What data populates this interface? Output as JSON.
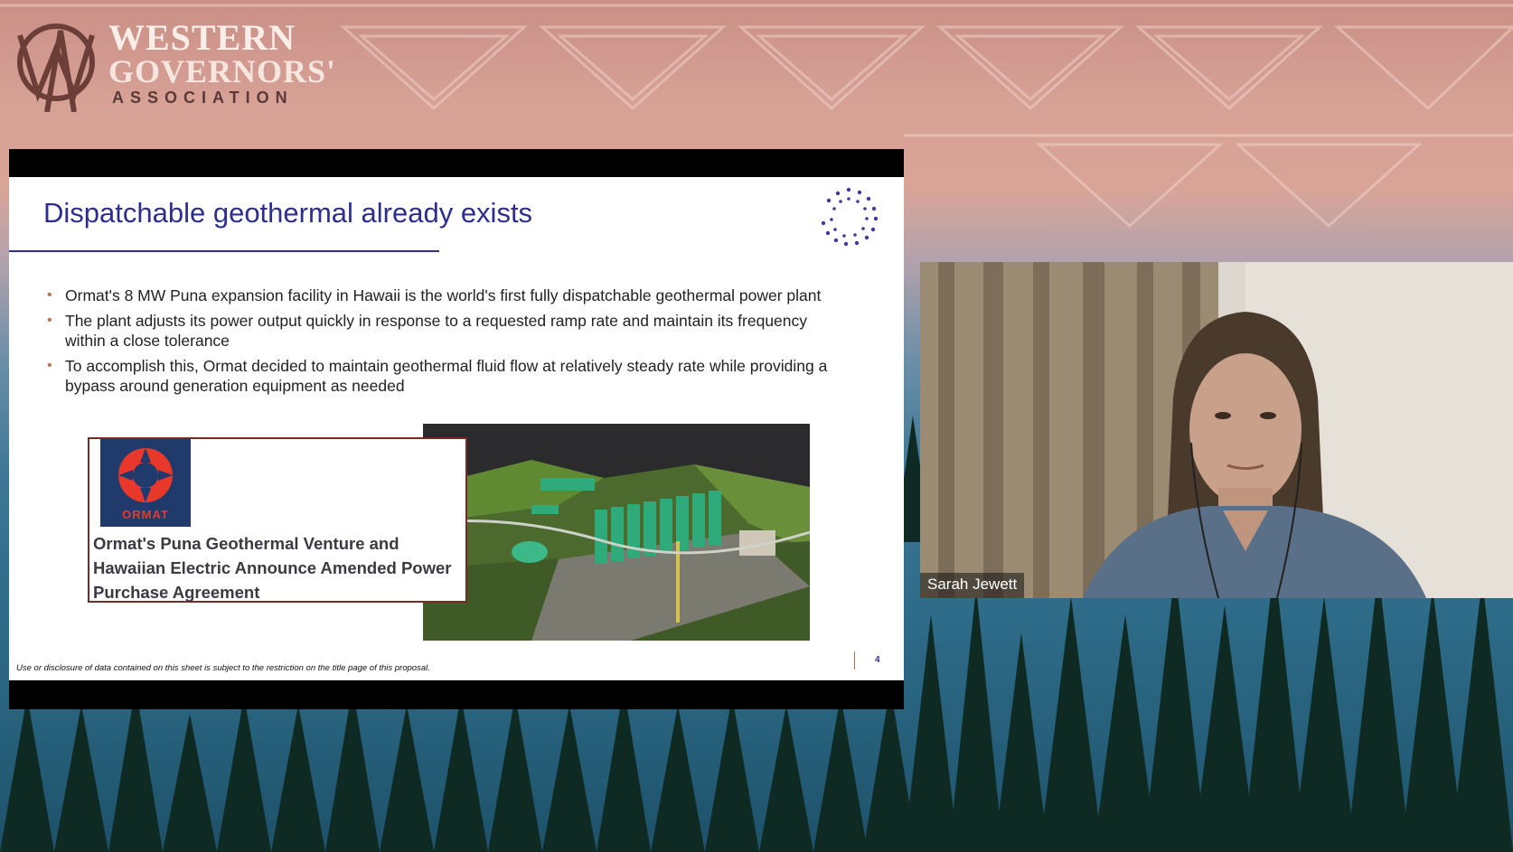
{
  "organization": {
    "line1": "WESTERN",
    "line2": "GOVERNORS'",
    "line3": "ASSOCIATION"
  },
  "slide": {
    "title": "Dispatchable geothermal already exists",
    "bullets": [
      {
        "text": "Ormat's 8 MW Puna expansion facility in Hawaii is the world's first fully dispatchable geothermal power plant"
      },
      {
        "text": "The plant adjusts its power output quickly in response to a requested ramp rate and maintain its frequency within a close tolerance"
      },
      {
        "text": "To accomplish this, Ormat decided to maintain geothermal fluid flow at relatively steady rate while providing a bypass around generation equipment as needed"
      }
    ],
    "news_card": {
      "brand": "ORMAT",
      "headline": "Ormat's Puna Geothermal Venture and Hawaiian Electric Announce Amended Power Purchase Agreement"
    },
    "disclaimer": "Use or disclosure of data contained on this sheet is subject to the restriction on the title page of this proposal.",
    "page_number": "4"
  },
  "participant": {
    "name": "Sarah Jewett"
  },
  "colors": {
    "title_blue": "#2d2e8f",
    "accent_rust": "#c0704f",
    "ormat_red": "#e8382c",
    "ormat_navy": "#1f3a6b"
  }
}
